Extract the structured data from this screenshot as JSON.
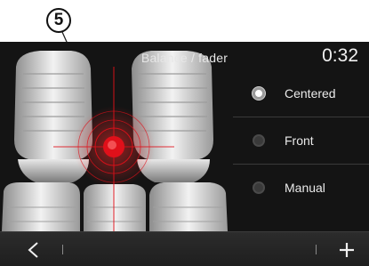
{
  "callout": {
    "number": "5"
  },
  "header": {
    "title": "Balance / fader",
    "time": "0:32"
  },
  "options": [
    {
      "label": "Centered",
      "selected": true
    },
    {
      "label": "Front",
      "selected": false
    },
    {
      "label": "Manual",
      "selected": false
    }
  ],
  "colors": {
    "accent": "#e0101a",
    "screen": "#141414",
    "seat": "#d8d8d8"
  },
  "icons": {
    "back": "chevron-left-icon",
    "add": "plus-icon"
  }
}
